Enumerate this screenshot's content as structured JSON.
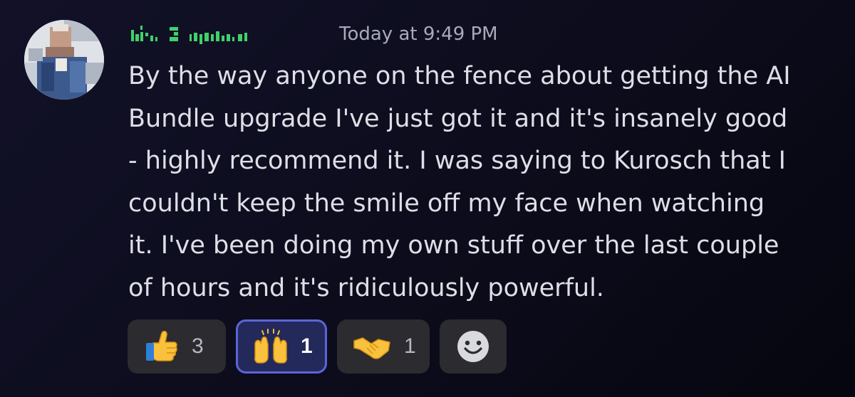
{
  "message": {
    "timestamp": "Today at 9:49 PM",
    "content_lines": [
      "By the way anyone on the fence about getting the AI",
      "Bundle upgrade I've just got it and it's insanely good",
      "- highly recommend it. I was saying to Kurosch that I",
      "couldn't keep the smile off my face when watching",
      "it. I've been doing my own stuff over the last couple",
      "of hours and it's ridiculously powerful."
    ]
  },
  "reactions": [
    {
      "emoji": "thumbs-up-icon",
      "count": "3",
      "active": false
    },
    {
      "emoji": "raising-hands-icon",
      "count": "1",
      "active": true
    },
    {
      "emoji": "handshake-icon",
      "count": "1",
      "active": false
    }
  ],
  "add_reaction": {
    "icon": "smiley-face-icon"
  },
  "colors": {
    "background": "#0c0c1c",
    "username": "#3fd16a",
    "text": "#dedfe6",
    "timestamp": "#a9aab8",
    "reaction_bg": "#2b2b30",
    "reaction_active_bg": "#24295c",
    "reaction_active_border": "#5a66d6"
  }
}
